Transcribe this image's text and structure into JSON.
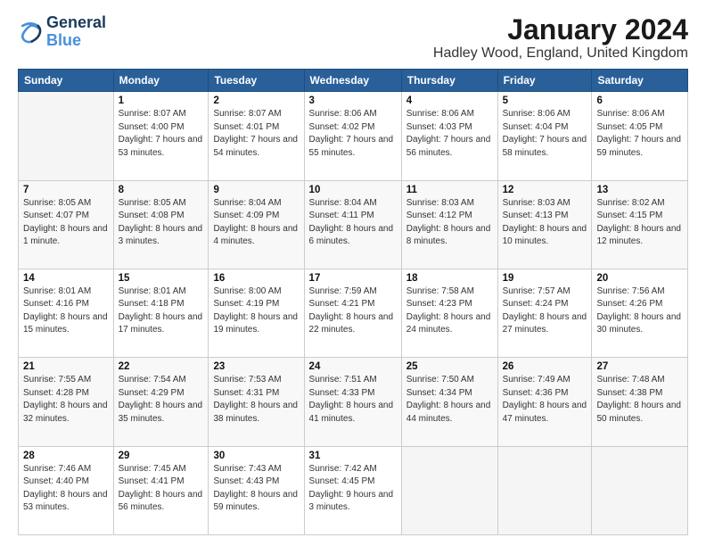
{
  "logo": {
    "line1": "General",
    "line2": "Blue"
  },
  "header": {
    "title": "January 2024",
    "subtitle": "Hadley Wood, England, United Kingdom"
  },
  "days_of_week": [
    "Sunday",
    "Monday",
    "Tuesday",
    "Wednesday",
    "Thursday",
    "Friday",
    "Saturday"
  ],
  "weeks": [
    [
      {
        "day": "",
        "sunrise": "",
        "sunset": "",
        "daylight": ""
      },
      {
        "day": "1",
        "sunrise": "Sunrise: 8:07 AM",
        "sunset": "Sunset: 4:00 PM",
        "daylight": "Daylight: 7 hours and 53 minutes."
      },
      {
        "day": "2",
        "sunrise": "Sunrise: 8:07 AM",
        "sunset": "Sunset: 4:01 PM",
        "daylight": "Daylight: 7 hours and 54 minutes."
      },
      {
        "day": "3",
        "sunrise": "Sunrise: 8:06 AM",
        "sunset": "Sunset: 4:02 PM",
        "daylight": "Daylight: 7 hours and 55 minutes."
      },
      {
        "day": "4",
        "sunrise": "Sunrise: 8:06 AM",
        "sunset": "Sunset: 4:03 PM",
        "daylight": "Daylight: 7 hours and 56 minutes."
      },
      {
        "day": "5",
        "sunrise": "Sunrise: 8:06 AM",
        "sunset": "Sunset: 4:04 PM",
        "daylight": "Daylight: 7 hours and 58 minutes."
      },
      {
        "day": "6",
        "sunrise": "Sunrise: 8:06 AM",
        "sunset": "Sunset: 4:05 PM",
        "daylight": "Daylight: 7 hours and 59 minutes."
      }
    ],
    [
      {
        "day": "7",
        "sunrise": "Sunrise: 8:05 AM",
        "sunset": "Sunset: 4:07 PM",
        "daylight": "Daylight: 8 hours and 1 minute."
      },
      {
        "day": "8",
        "sunrise": "Sunrise: 8:05 AM",
        "sunset": "Sunset: 4:08 PM",
        "daylight": "Daylight: 8 hours and 3 minutes."
      },
      {
        "day": "9",
        "sunrise": "Sunrise: 8:04 AM",
        "sunset": "Sunset: 4:09 PM",
        "daylight": "Daylight: 8 hours and 4 minutes."
      },
      {
        "day": "10",
        "sunrise": "Sunrise: 8:04 AM",
        "sunset": "Sunset: 4:11 PM",
        "daylight": "Daylight: 8 hours and 6 minutes."
      },
      {
        "day": "11",
        "sunrise": "Sunrise: 8:03 AM",
        "sunset": "Sunset: 4:12 PM",
        "daylight": "Daylight: 8 hours and 8 minutes."
      },
      {
        "day": "12",
        "sunrise": "Sunrise: 8:03 AM",
        "sunset": "Sunset: 4:13 PM",
        "daylight": "Daylight: 8 hours and 10 minutes."
      },
      {
        "day": "13",
        "sunrise": "Sunrise: 8:02 AM",
        "sunset": "Sunset: 4:15 PM",
        "daylight": "Daylight: 8 hours and 12 minutes."
      }
    ],
    [
      {
        "day": "14",
        "sunrise": "Sunrise: 8:01 AM",
        "sunset": "Sunset: 4:16 PM",
        "daylight": "Daylight: 8 hours and 15 minutes."
      },
      {
        "day": "15",
        "sunrise": "Sunrise: 8:01 AM",
        "sunset": "Sunset: 4:18 PM",
        "daylight": "Daylight: 8 hours and 17 minutes."
      },
      {
        "day": "16",
        "sunrise": "Sunrise: 8:00 AM",
        "sunset": "Sunset: 4:19 PM",
        "daylight": "Daylight: 8 hours and 19 minutes."
      },
      {
        "day": "17",
        "sunrise": "Sunrise: 7:59 AM",
        "sunset": "Sunset: 4:21 PM",
        "daylight": "Daylight: 8 hours and 22 minutes."
      },
      {
        "day": "18",
        "sunrise": "Sunrise: 7:58 AM",
        "sunset": "Sunset: 4:23 PM",
        "daylight": "Daylight: 8 hours and 24 minutes."
      },
      {
        "day": "19",
        "sunrise": "Sunrise: 7:57 AM",
        "sunset": "Sunset: 4:24 PM",
        "daylight": "Daylight: 8 hours and 27 minutes."
      },
      {
        "day": "20",
        "sunrise": "Sunrise: 7:56 AM",
        "sunset": "Sunset: 4:26 PM",
        "daylight": "Daylight: 8 hours and 30 minutes."
      }
    ],
    [
      {
        "day": "21",
        "sunrise": "Sunrise: 7:55 AM",
        "sunset": "Sunset: 4:28 PM",
        "daylight": "Daylight: 8 hours and 32 minutes."
      },
      {
        "day": "22",
        "sunrise": "Sunrise: 7:54 AM",
        "sunset": "Sunset: 4:29 PM",
        "daylight": "Daylight: 8 hours and 35 minutes."
      },
      {
        "day": "23",
        "sunrise": "Sunrise: 7:53 AM",
        "sunset": "Sunset: 4:31 PM",
        "daylight": "Daylight: 8 hours and 38 minutes."
      },
      {
        "day": "24",
        "sunrise": "Sunrise: 7:51 AM",
        "sunset": "Sunset: 4:33 PM",
        "daylight": "Daylight: 8 hours and 41 minutes."
      },
      {
        "day": "25",
        "sunrise": "Sunrise: 7:50 AM",
        "sunset": "Sunset: 4:34 PM",
        "daylight": "Daylight: 8 hours and 44 minutes."
      },
      {
        "day": "26",
        "sunrise": "Sunrise: 7:49 AM",
        "sunset": "Sunset: 4:36 PM",
        "daylight": "Daylight: 8 hours and 47 minutes."
      },
      {
        "day": "27",
        "sunrise": "Sunrise: 7:48 AM",
        "sunset": "Sunset: 4:38 PM",
        "daylight": "Daylight: 8 hours and 50 minutes."
      }
    ],
    [
      {
        "day": "28",
        "sunrise": "Sunrise: 7:46 AM",
        "sunset": "Sunset: 4:40 PM",
        "daylight": "Daylight: 8 hours and 53 minutes."
      },
      {
        "day": "29",
        "sunrise": "Sunrise: 7:45 AM",
        "sunset": "Sunset: 4:41 PM",
        "daylight": "Daylight: 8 hours and 56 minutes."
      },
      {
        "day": "30",
        "sunrise": "Sunrise: 7:43 AM",
        "sunset": "Sunset: 4:43 PM",
        "daylight": "Daylight: 8 hours and 59 minutes."
      },
      {
        "day": "31",
        "sunrise": "Sunrise: 7:42 AM",
        "sunset": "Sunset: 4:45 PM",
        "daylight": "Daylight: 9 hours and 3 minutes."
      },
      {
        "day": "",
        "sunrise": "",
        "sunset": "",
        "daylight": ""
      },
      {
        "day": "",
        "sunrise": "",
        "sunset": "",
        "daylight": ""
      },
      {
        "day": "",
        "sunrise": "",
        "sunset": "",
        "daylight": ""
      }
    ]
  ]
}
